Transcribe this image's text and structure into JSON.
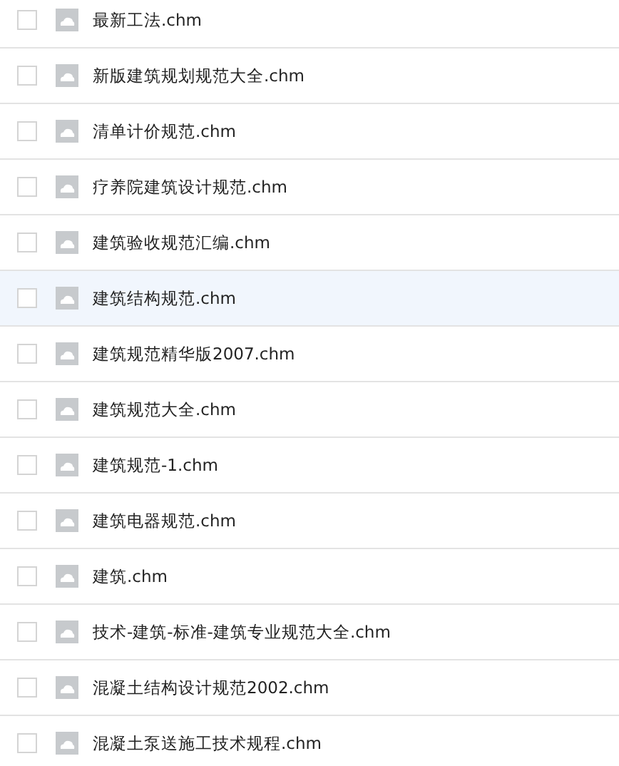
{
  "files": [
    {
      "name": "最新工法.chm",
      "checked": false,
      "highlighted": false
    },
    {
      "name": "新版建筑规划规范大全.chm",
      "checked": false,
      "highlighted": false
    },
    {
      "name": "清单计价规范.chm",
      "checked": false,
      "highlighted": false
    },
    {
      "name": "疗养院建筑设计规范.chm",
      "checked": false,
      "highlighted": false
    },
    {
      "name": "建筑验收规范汇编.chm",
      "checked": false,
      "highlighted": false
    },
    {
      "name": "建筑结构规范.chm",
      "checked": false,
      "highlighted": true
    },
    {
      "name": "建筑规范精华版2007.chm",
      "checked": false,
      "highlighted": false
    },
    {
      "name": "建筑规范大全.chm",
      "checked": false,
      "highlighted": false
    },
    {
      "name": "建筑规范-1.chm",
      "checked": false,
      "highlighted": false
    },
    {
      "name": "建筑电器规范.chm",
      "checked": false,
      "highlighted": false
    },
    {
      "name": "建筑.chm",
      "checked": false,
      "highlighted": false
    },
    {
      "name": "技术-建筑-标准-建筑专业规范大全.chm",
      "checked": false,
      "highlighted": false
    },
    {
      "name": "混凝土结构设计规范2002.chm",
      "checked": false,
      "highlighted": false
    },
    {
      "name": "混凝土泵送施工技术规程.chm",
      "checked": false,
      "highlighted": false
    }
  ]
}
